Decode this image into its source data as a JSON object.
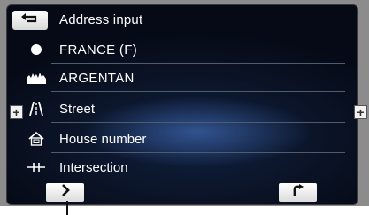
{
  "header": {
    "title": "Address input",
    "back_icon": "return-arrow-icon"
  },
  "rows": [
    {
      "label": "FRANCE (F)",
      "icon": "filled-circle-icon"
    },
    {
      "label": "ARGENTAN",
      "icon": "city-skyline-icon"
    },
    {
      "label": "Street",
      "icon": "road-icon"
    },
    {
      "label": "House number",
      "icon": "house-icon"
    },
    {
      "label": "Intersection",
      "icon": "intersection-icon"
    }
  ],
  "side_buttons": {
    "left": "+",
    "right": "+"
  },
  "footer": {
    "next_icon": "chevron-right-icon",
    "confirm_icon": "turn-arrow-icon"
  },
  "colors": {
    "panel_bg": "#0b1428",
    "highlight": "#3c64aa",
    "text": "#ffffff"
  }
}
